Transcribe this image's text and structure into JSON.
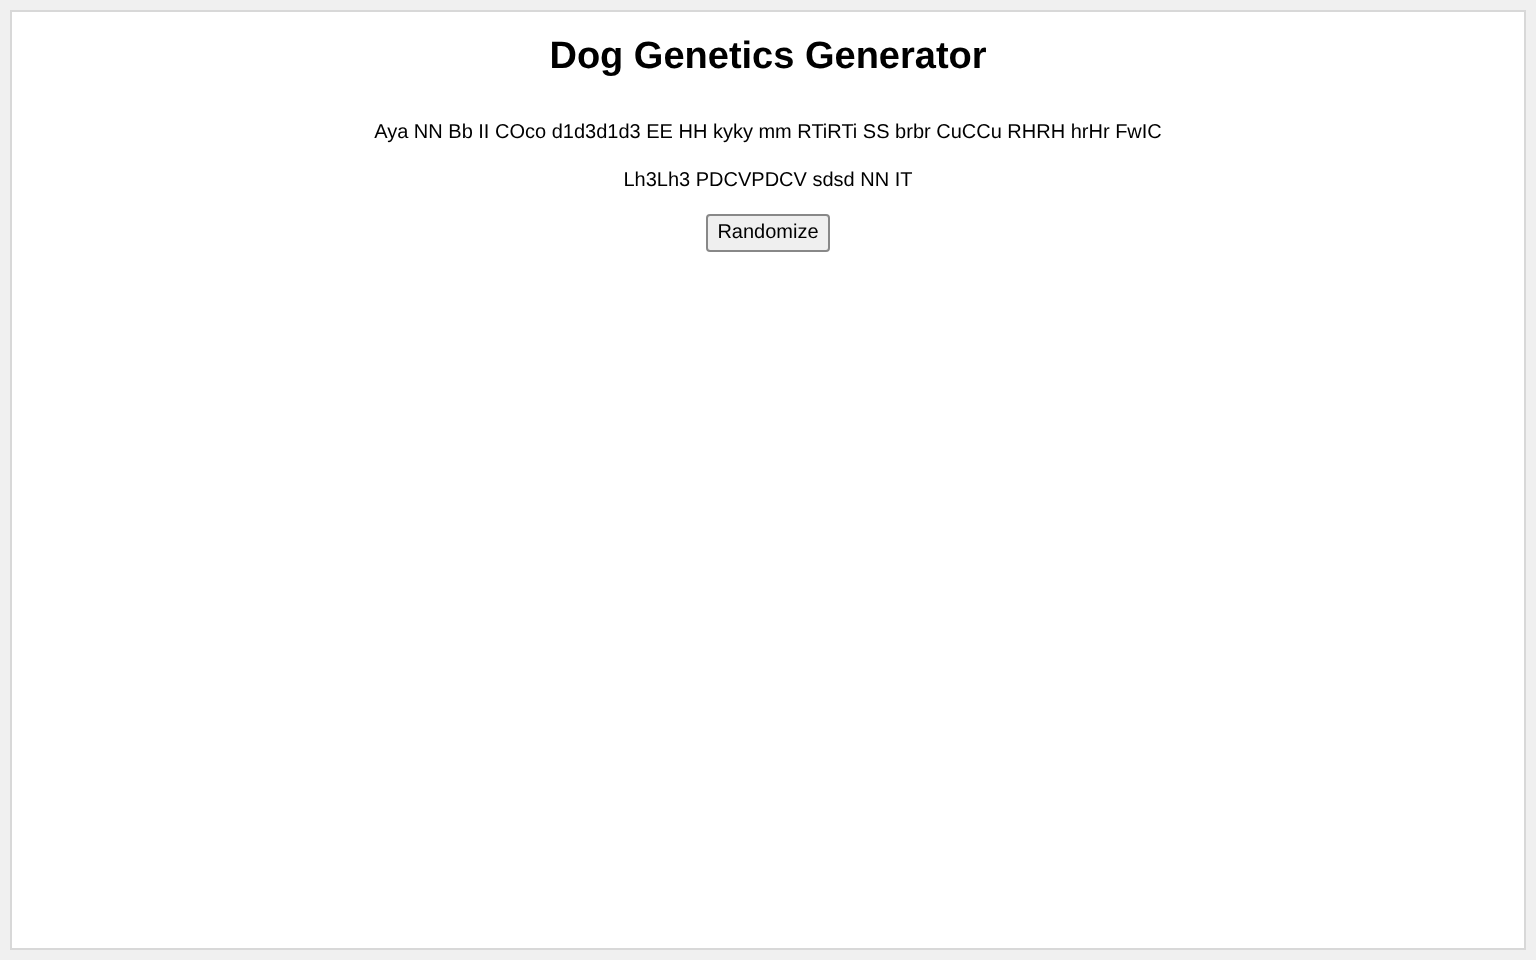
{
  "title": "Dog Genetics Generator",
  "genotype_lines": [
    "Aya NN Bb II COco d1d3d1d3 EE HH kyky mm RTiRTi SS brbr CuCCu RHRH hrHr FwIC",
    "Lh3Lh3 PDCVPDCV sdsd NN IT"
  ],
  "buttons": [
    "Randomize"
  ]
}
